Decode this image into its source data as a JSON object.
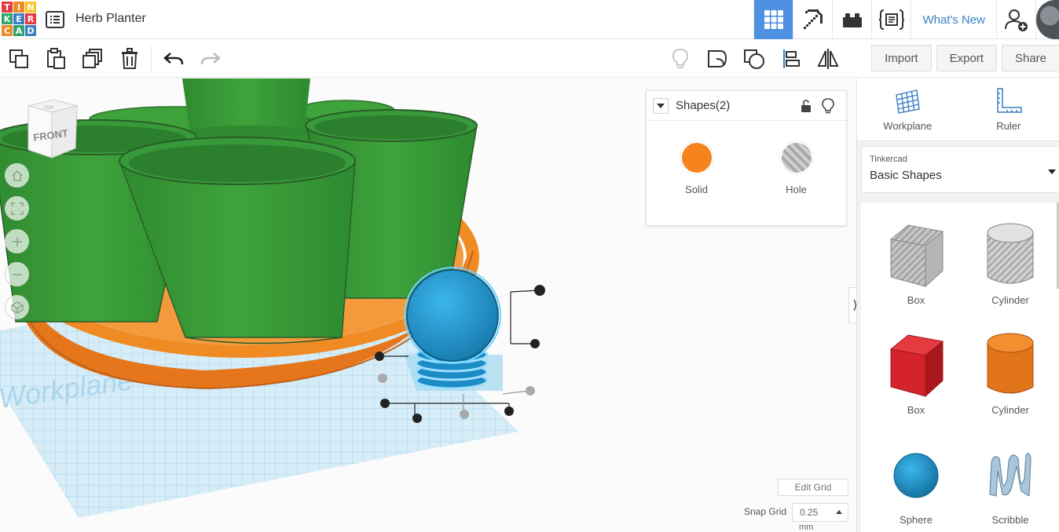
{
  "app": {
    "logo_letters": [
      "T",
      "I",
      "N",
      "K",
      "E",
      "R",
      "C",
      "A",
      "D"
    ],
    "logo_colors": [
      "#e33b3f",
      "#f08a25",
      "#f5c624",
      "#2fa36b",
      "#3b7fc4",
      "#e33b3f",
      "#f08a25",
      "#2fa36b",
      "#3b7fc4"
    ],
    "document_title": "Herb Planter",
    "whats_new_label": "What's New"
  },
  "header_icons": [
    "grid-3d-design-icon",
    "pickaxe-minecraft-icon",
    "lego-bricks-icon",
    "codeblocks-icon",
    "add-user-icon"
  ],
  "toolbar": {
    "left_icons": [
      "copy-icon",
      "paste-icon",
      "duplicate-icon",
      "delete-icon",
      "undo-icon",
      "redo-icon"
    ],
    "mid_icons": [
      "lightbulb-icon",
      "group-icon",
      "ungroup-icon",
      "align-icon",
      "mirror-icon"
    ],
    "import_label": "Import",
    "export_label": "Export",
    "share_label": "Share"
  },
  "viewcube": {
    "top_label": "TOP",
    "front_label": "FRONT"
  },
  "workplane_label": "Workplane",
  "inspector": {
    "title": "Shapes(2)",
    "solid_label": "Solid",
    "hole_label": "Hole",
    "solid_color": "#f5841f"
  },
  "grid": {
    "edit_grid_label": "Edit Grid",
    "snap_grid_label": "Snap Grid",
    "snap_value": "0.25",
    "snap_unit": "mm"
  },
  "right_panel": {
    "workplane_label": "Workplane",
    "ruler_label": "Ruler",
    "library_source": "Tinkercad",
    "library_name": "Basic Shapes",
    "shapes": [
      {
        "label": "Box",
        "kind": "box-hole"
      },
      {
        "label": "Cylinder",
        "kind": "cylinder-hole"
      },
      {
        "label": "Box",
        "kind": "box-solid"
      },
      {
        "label": "Cylinder",
        "kind": "cylinder-solid"
      },
      {
        "label": "Sphere",
        "kind": "sphere"
      },
      {
        "label": "Scribble",
        "kind": "scribble"
      }
    ]
  },
  "colors": {
    "accent": "#4d8fe1",
    "planter_green": "#3d9b3a",
    "saucer_orange": "#f08a22",
    "selection_blue": "#1ea0d8",
    "box_red": "#d8232a"
  }
}
